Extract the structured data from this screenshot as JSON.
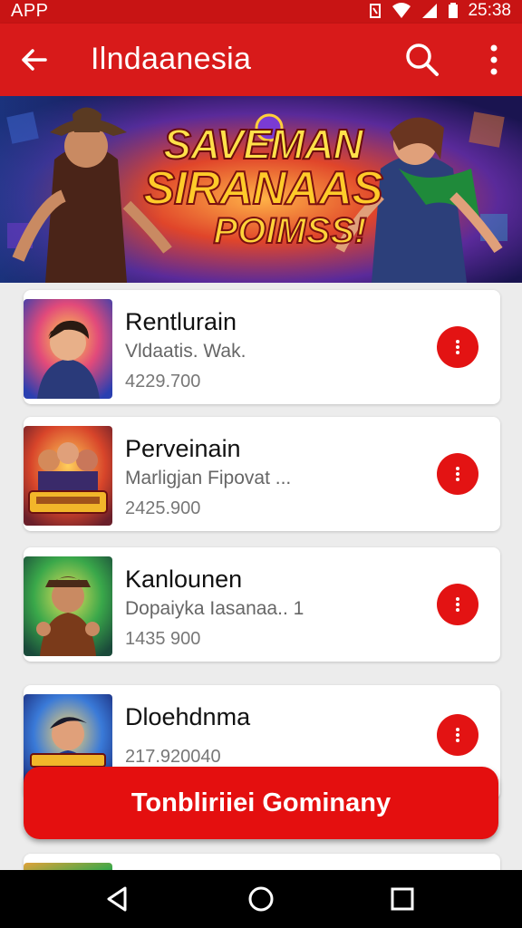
{
  "status_bar": {
    "left_text": "APP",
    "time": "25:38"
  },
  "app_bar": {
    "title": "Ilndaanesia"
  },
  "banner": {
    "line1": "SAVEMAN",
    "line2": "SIRANAAS",
    "line3": "POIMSS!"
  },
  "games": [
    {
      "name": "Rentlurain",
      "desc": "Vldaatis. Wak.",
      "price": "4229.700"
    },
    {
      "name": "Perveinain",
      "desc": "Marligjan Fipovat ...",
      "price": "2425.900"
    },
    {
      "name": "Kanlounen",
      "desc": "Dopaiyka Iasanaa.. 1",
      "price": "1435 900"
    },
    {
      "name": "Dloehdnma",
      "desc": "",
      "price": "217.920040"
    }
  ],
  "cta": {
    "label": "Tonbliriiei Gominany"
  },
  "colors": {
    "primary": "#d81a1a",
    "accent": "#e31313",
    "background": "#ececec"
  },
  "icons": [
    "back-arrow-icon",
    "search-icon",
    "more-vertical-icon",
    "menu-dots-icon",
    "nav-back-icon",
    "nav-home-icon",
    "nav-recents-icon"
  ]
}
